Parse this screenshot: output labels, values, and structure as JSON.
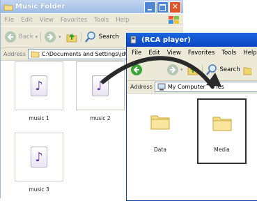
{
  "window1": {
    "title": "Music Folder",
    "menu": [
      "File",
      "Edit",
      "View",
      "Favorites",
      "Tools",
      "Help"
    ],
    "toolbar": {
      "back": "Back",
      "search": "Search"
    },
    "address_label": "Address",
    "address_value": "C:\\Documents and Settings\\jd\\Desk",
    "files": [
      {
        "name": "music 1"
      },
      {
        "name": "music 2"
      },
      {
        "name": "music 3"
      }
    ]
  },
  "window2": {
    "title": "(RCA player)",
    "menu": [
      "File",
      "Edit",
      "View",
      "Favorites",
      "Tools",
      "Help"
    ],
    "toolbar": {
      "search": "Search"
    },
    "address_label": "Address",
    "address_value": "My Computer",
    "address_suffix": "S ies",
    "folders": [
      {
        "name": "Data"
      },
      {
        "name": "Media"
      }
    ]
  },
  "colors": {
    "window1_title_bg": "#a8c3e8",
    "window2_title_bg": "#0a4fc9",
    "chrome_bg": "#ece9d8",
    "arrow": "#2a2a2a",
    "close_btn": "#e0562c",
    "note_icon": "#6a3aa8",
    "folder_fill": "#f7dd86"
  },
  "icons": [
    "folder-icon",
    "back-icon",
    "forward-icon",
    "search-icon",
    "go-up-folder-icon",
    "music-note-icon",
    "windows-logo-icon",
    "player-icon",
    "my-computer-icon"
  ]
}
